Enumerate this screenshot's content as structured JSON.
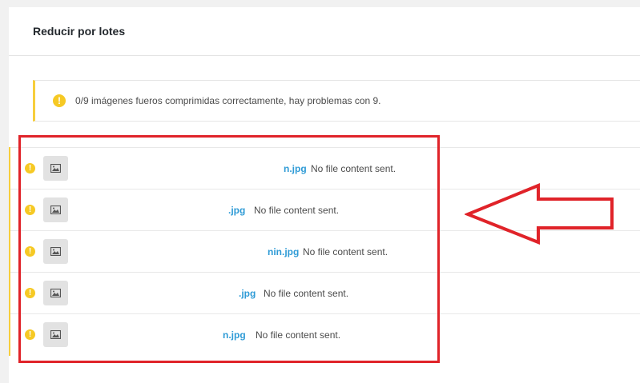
{
  "panel": {
    "title": "Reducir por lotes"
  },
  "notice": {
    "icon": "warning-icon",
    "text": "0/9 imágenes fueros comprimidas correctamente, hay problemas con 9."
  },
  "rows": [
    {
      "filename": "n.jpg",
      "status": "No file content sent."
    },
    {
      "filename": ".jpg",
      "status": "No file content sent."
    },
    {
      "filename": "nin.jpg",
      "status": "No file content sent."
    },
    {
      "filename": ".jpg",
      "status": "No file content sent."
    },
    {
      "filename": "n.jpg",
      "status": "No file content sent."
    }
  ],
  "colors": {
    "warning": "#f6c924",
    "link": "#2f9bd6",
    "annotation": "#e02329"
  }
}
